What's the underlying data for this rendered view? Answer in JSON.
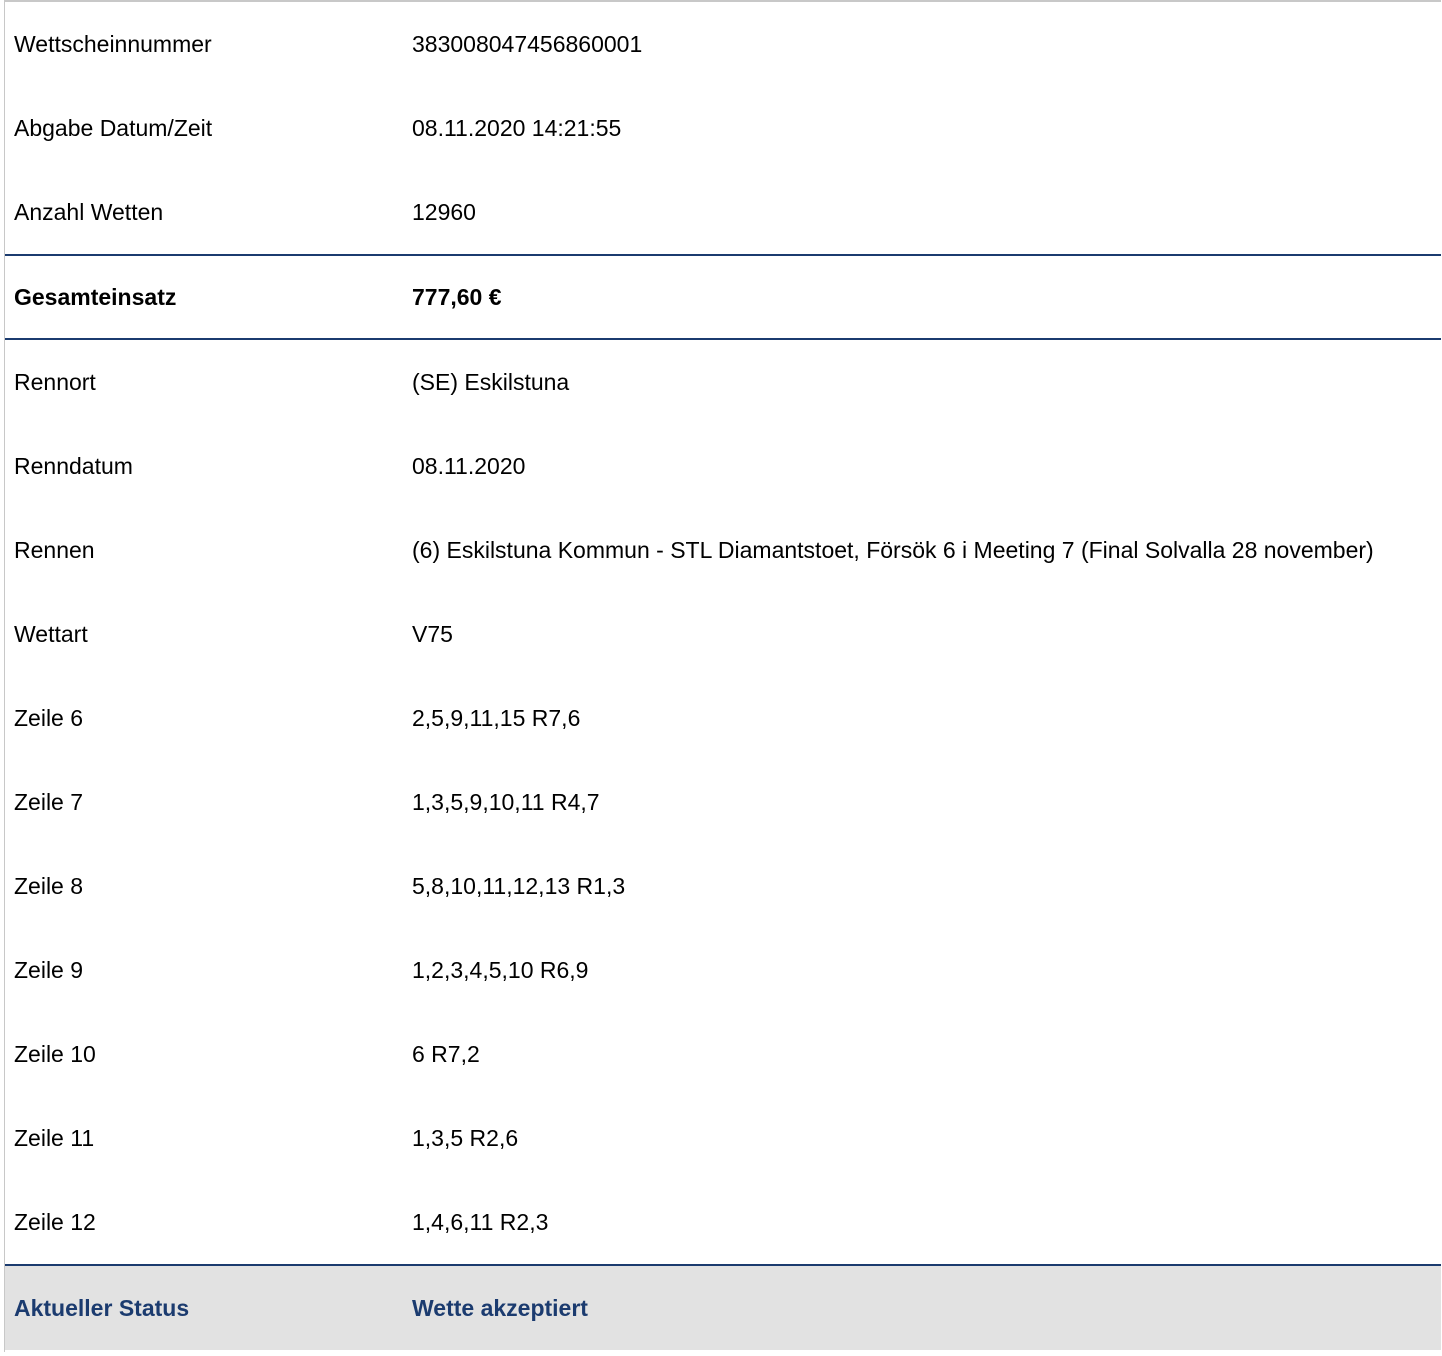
{
  "summary": [
    {
      "label": "Wettscheinnummer",
      "value": "383008047456860001"
    },
    {
      "label": "Abgabe Datum/Zeit",
      "value": "08.11.2020 14:21:55"
    },
    {
      "label": "Anzahl Wetten",
      "value": "12960"
    }
  ],
  "total": {
    "label": "Gesamteinsatz",
    "value": "777,60 €"
  },
  "details": [
    {
      "label": "Rennort",
      "value": "(SE) Eskilstuna"
    },
    {
      "label": "Renndatum",
      "value": "08.11.2020"
    },
    {
      "label": "Rennen",
      "value": "(6) Eskilstuna Kommun - STL Diamantstoet, Försök 6 i Meeting 7 (Final Solvalla 28 november)"
    },
    {
      "label": "Wettart",
      "value": "V75"
    },
    {
      "label": "Zeile 6",
      "value": "2,5,9,11,15 R7,6"
    },
    {
      "label": "Zeile 7",
      "value": "1,3,5,9,10,11 R4,7"
    },
    {
      "label": "Zeile 8",
      "value": "5,8,10,11,12,13 R1,3"
    },
    {
      "label": "Zeile 9",
      "value": "1,2,3,4,5,10 R6,9"
    },
    {
      "label": "Zeile 10",
      "value": "6 R7,2"
    },
    {
      "label": "Zeile 11",
      "value": "1,3,5 R2,6"
    },
    {
      "label": "Zeile 12",
      "value": "1,4,6,11 R2,3"
    }
  ],
  "status": {
    "label": "Aktueller Status",
    "value": "Wette akzeptiert"
  },
  "colors": {
    "accent": "#1b3b6f",
    "status_bg": "#e2e2e2",
    "border": "#c8c8c8"
  }
}
